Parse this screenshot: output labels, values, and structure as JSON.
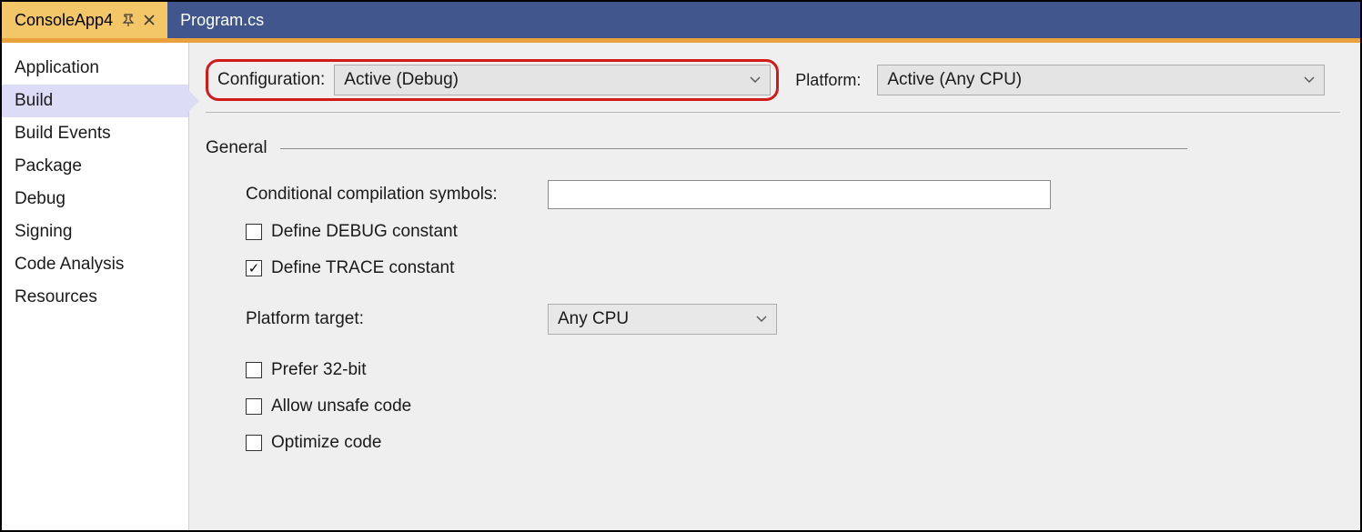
{
  "tabs": {
    "active": {
      "label": "ConsoleApp4"
    },
    "other": {
      "label": "Program.cs"
    }
  },
  "sidebar": {
    "items": [
      {
        "label": "Application"
      },
      {
        "label": "Build"
      },
      {
        "label": "Build Events"
      },
      {
        "label": "Package"
      },
      {
        "label": "Debug"
      },
      {
        "label": "Signing"
      },
      {
        "label": "Code Analysis"
      },
      {
        "label": "Resources"
      }
    ],
    "selectedIndex": 1
  },
  "toprow": {
    "configuration_label": "Configuration:",
    "configuration_value": "Active (Debug)",
    "platform_label": "Platform:",
    "platform_value": "Active (Any CPU)"
  },
  "section": {
    "title": "General",
    "conditional_label": "Conditional compilation symbols:",
    "conditional_value": "",
    "define_debug_label": "Define DEBUG constant",
    "define_debug_checked": false,
    "define_trace_label": "Define TRACE constant",
    "define_trace_checked": true,
    "platform_target_label": "Platform target:",
    "platform_target_value": "Any CPU",
    "prefer32_label": "Prefer 32-bit",
    "prefer32_checked": false,
    "unsafe_label": "Allow unsafe code",
    "unsafe_checked": false,
    "optimize_label": "Optimize code",
    "optimize_checked": false
  }
}
